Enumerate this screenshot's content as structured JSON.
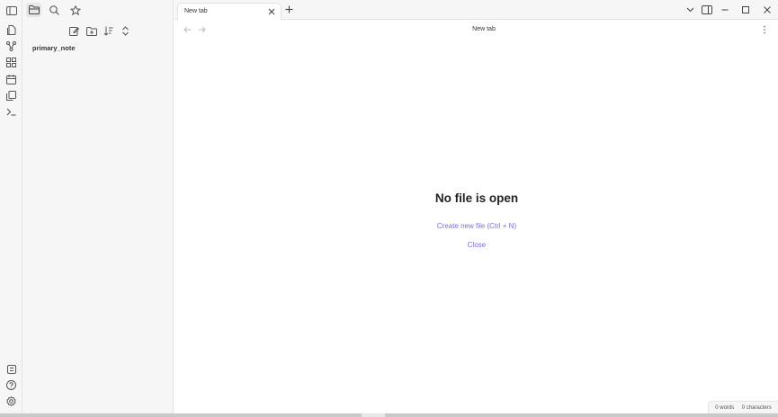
{
  "ribbon": {
    "top_items": [
      {
        "icon": "open-quick-switcher-icon"
      },
      {
        "icon": "graph-view-icon"
      },
      {
        "icon": "canvas-icon"
      },
      {
        "icon": "daily-note-icon"
      },
      {
        "icon": "templates-icon"
      },
      {
        "icon": "command-palette-icon"
      }
    ],
    "bottom_items": [
      {
        "icon": "vault-switcher-icon"
      },
      {
        "icon": "help-icon"
      },
      {
        "icon": "settings-icon"
      }
    ]
  },
  "sidebar": {
    "top_icons": [
      "files-icon",
      "search-icon",
      "bookmarks-icon"
    ],
    "nav_tools": [
      "new-note-icon",
      "new-folder-icon",
      "sort-icon",
      "collapse-icon"
    ],
    "files": [
      {
        "name": "primary_note"
      }
    ]
  },
  "tabs": [
    {
      "title": "New tab"
    }
  ],
  "view": {
    "title": "New tab"
  },
  "empty_state": {
    "title": "No file is open",
    "create_label": "Create new file (Ctrl + N)",
    "close_label": "Close"
  },
  "status": {
    "words": "0 words",
    "characters": "0 characters"
  },
  "colors": {
    "accent": "#7b6cd9",
    "sidebar_bg": "#f6f6f6",
    "border": "#e3e3e3"
  }
}
